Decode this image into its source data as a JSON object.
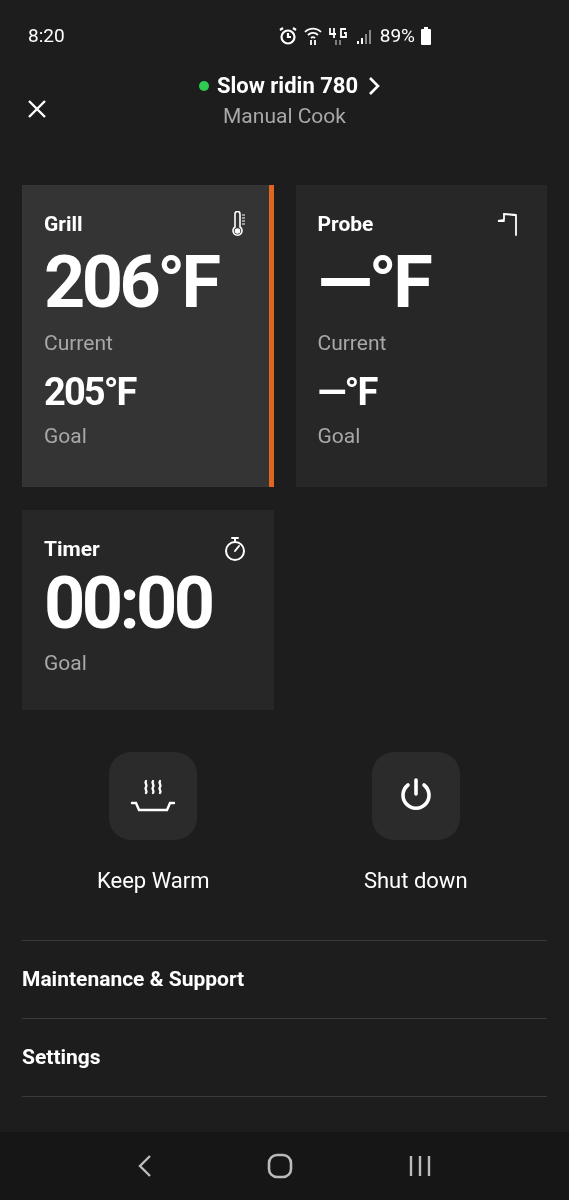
{
  "status_bar": {
    "time": "8:20",
    "battery": "89%"
  },
  "header": {
    "title": "Slow ridin 780",
    "subtitle": "Manual Cook",
    "connected": true
  },
  "cards": [
    {
      "kind": "grill",
      "label": "Grill",
      "current": "206°F",
      "current_label": "Current",
      "goal": "205°F",
      "goal_label": "Goal",
      "selected": true
    },
    {
      "kind": "probe",
      "label": "Probe",
      "current": "—°F",
      "current_label": "Current",
      "goal": "—°F",
      "goal_label": "Goal",
      "selected": false
    },
    {
      "kind": "timer",
      "label": "Timer",
      "current": "00:00",
      "goal_label": "Goal",
      "selected": false
    }
  ],
  "actions": [
    {
      "kind": "keep_warm",
      "label": "Keep Warm"
    },
    {
      "kind": "shutdown",
      "label": "Shut down"
    }
  ],
  "menu": [
    {
      "label": "Maintenance & Support"
    },
    {
      "label": "Settings"
    }
  ]
}
